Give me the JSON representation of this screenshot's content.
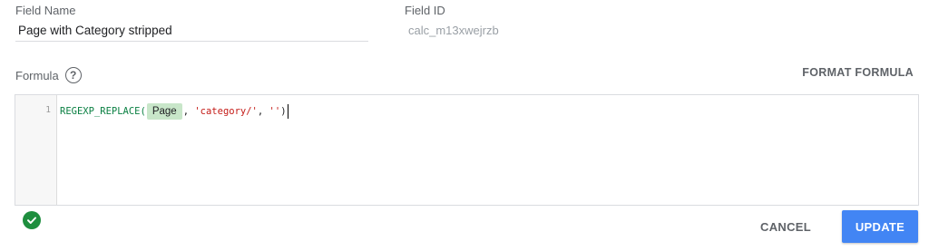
{
  "field_name": {
    "label": "Field Name",
    "value": "Page with Category stripped"
  },
  "field_id": {
    "label": "Field ID",
    "value": "calc_m13xwejrzb"
  },
  "formula": {
    "label": "Formula",
    "help_icon": "help-circle-icon",
    "format_label": "FORMAT FORMULA",
    "editor": {
      "line_number": "1",
      "function_name": "REGEXP_REPLACE(",
      "field_chip": "Page",
      "sep1": ", ",
      "arg_pattern": "'category/'",
      "sep2": ", ",
      "arg_replacement": "''",
      "close_paren": ")"
    }
  },
  "status": {
    "icon": "check-circle-icon",
    "color": "#1e8e3e"
  },
  "actions": {
    "cancel_label": "CANCEL",
    "update_label": "UPDATE",
    "update_color": "#4285f4"
  }
}
